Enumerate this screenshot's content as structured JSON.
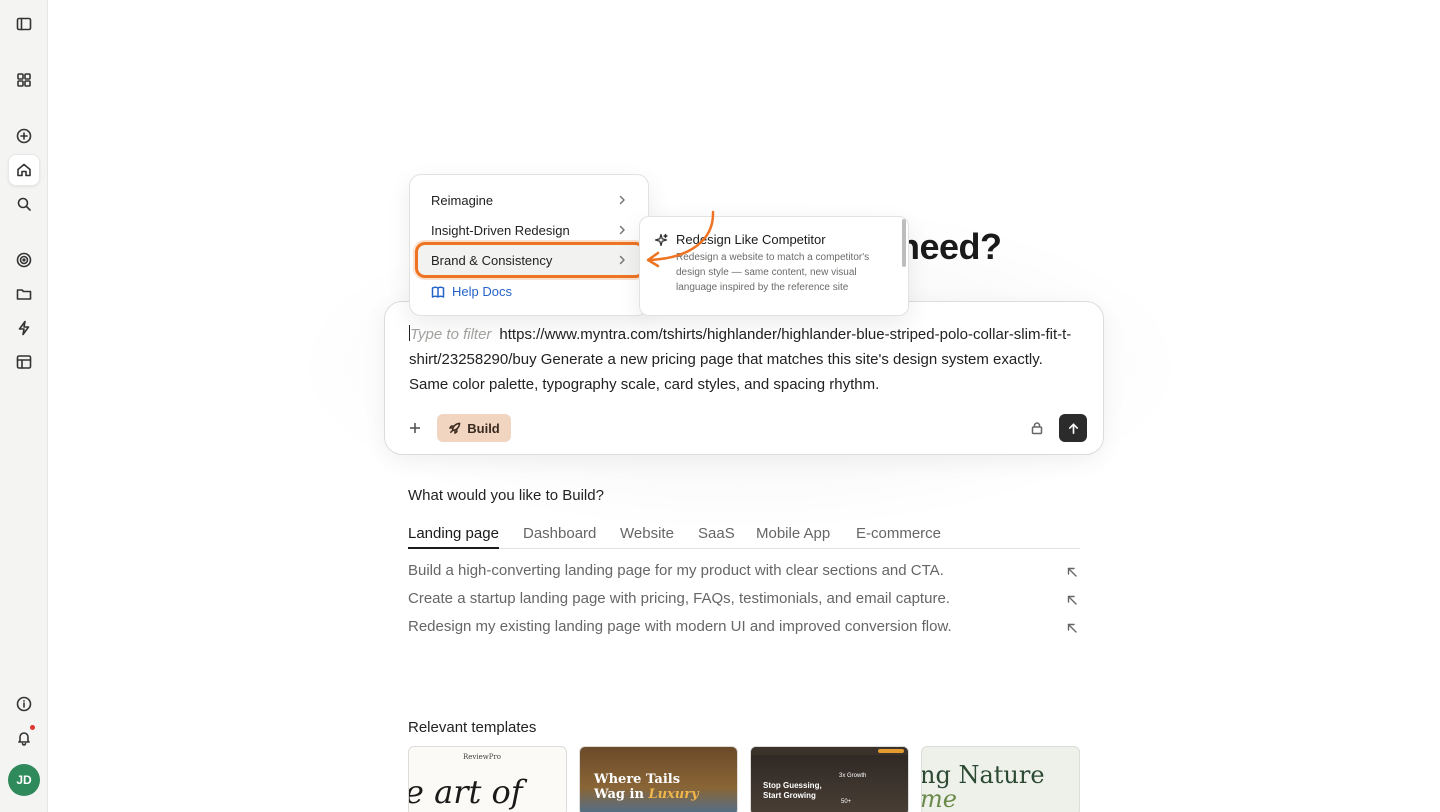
{
  "sidebar": {
    "avatar_initials": "JD",
    "icons": [
      "sidebar-toggle-icon",
      "apps-grid-icon",
      "plus-circle-icon",
      "home-icon",
      "search-icon",
      "target-icon",
      "folder-icon",
      "lightning-icon",
      "layout-icon",
      "info-icon",
      "bell-icon"
    ]
  },
  "headline": "need?",
  "composer": {
    "filter_placeholder": "Type to filter",
    "prompt_text": "https://www.myntra.com/tshirts/highlander/highlander-blue-striped-polo-collar-slim-fit-t-shirt/23258290/buy Generate a new pricing page that matches this site's design system exactly. Same color palette, typography scale, card styles, and spacing rhythm.",
    "build_label": "Build"
  },
  "menu": {
    "items": [
      {
        "label": "Reimagine"
      },
      {
        "label": "Insight-Driven Redesign"
      },
      {
        "label": "Brand & Consistency"
      }
    ],
    "help_label": "Help Docs"
  },
  "submenu": {
    "title": "Redesign Like Competitor",
    "description": "Redesign a website to match a competitor's design style — same content, new visual language inspired by the reference site"
  },
  "build_section": {
    "question": "What would you like to Build?",
    "tabs": [
      "Landing page",
      "Dashboard",
      "Website",
      "SaaS",
      "Mobile App",
      "E-commerce"
    ],
    "suggestions": [
      "Build a high-converting landing page for my product with clear sections and CTA.",
      "Create a startup landing page with pricing, FAQs, testimonials, and email capture.",
      "Redesign my existing landing page with modern UI and improved conversion flow."
    ]
  },
  "templates": {
    "title": "Relevant templates",
    "cards": [
      {
        "brand": "ReviewPro",
        "headline": "e art of"
      },
      {
        "headline_1": "Where Tails",
        "headline_2": "Wag in",
        "headline_3": "Luxury"
      },
      {
        "headline": "Stop Guessing, Start Growing",
        "stat_1": "3x Growth",
        "stat_2": "50+"
      },
      {
        "headline_1": "ng Nature",
        "headline_2": "me"
      }
    ]
  },
  "colors": {
    "accent_orange": "#ee7322",
    "build_button_bg": "#f1d5c0",
    "link_blue": "#2563c9",
    "avatar_green": "#2f8a5b"
  }
}
